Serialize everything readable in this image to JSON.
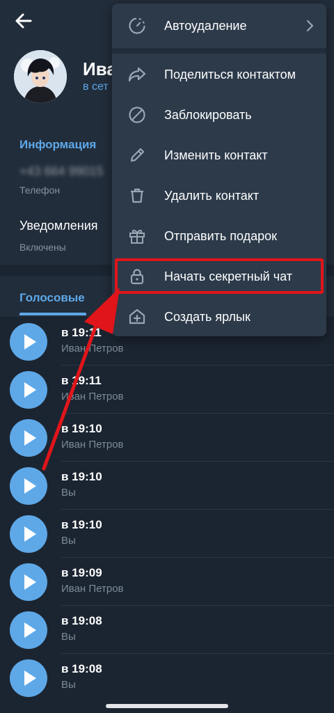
{
  "profile": {
    "name": "Ива",
    "status": "в сет"
  },
  "info": {
    "title": "Информация",
    "phone_value": "+43 664 99015",
    "phone_label": "Телефон",
    "notifications_value": "Уведомления",
    "notifications_label": "Включены"
  },
  "tabs": {
    "voice": "Голосовые"
  },
  "voice_messages": [
    {
      "time": "в 19:11",
      "author": "Иван Петров"
    },
    {
      "time": "в 19:11",
      "author": "Иван Петров"
    },
    {
      "time": "в 19:10",
      "author": "Иван Петров"
    },
    {
      "time": "в 19:10",
      "author": "Вы"
    },
    {
      "time": "в 19:10",
      "author": "Вы"
    },
    {
      "time": "в 19:09",
      "author": "Иван Петров"
    },
    {
      "time": "в 19:08",
      "author": "Вы"
    },
    {
      "time": "в 19:08",
      "author": "Вы"
    }
  ],
  "menu": {
    "autodelete": "Автоудаление",
    "share_contact": "Поделиться контактом",
    "block": "Заблокировать",
    "edit_contact": "Изменить контакт",
    "delete_contact": "Удалить контакт",
    "send_gift": "Отправить подарок",
    "secret_chat": "Начать секретный чат",
    "create_shortcut": "Создать ярлык"
  },
  "colors": {
    "accent": "#5ea8e8",
    "background": "#1b2531",
    "panel": "#222d3b",
    "menu": "#2c3a4a",
    "highlight": "#e0151a"
  }
}
